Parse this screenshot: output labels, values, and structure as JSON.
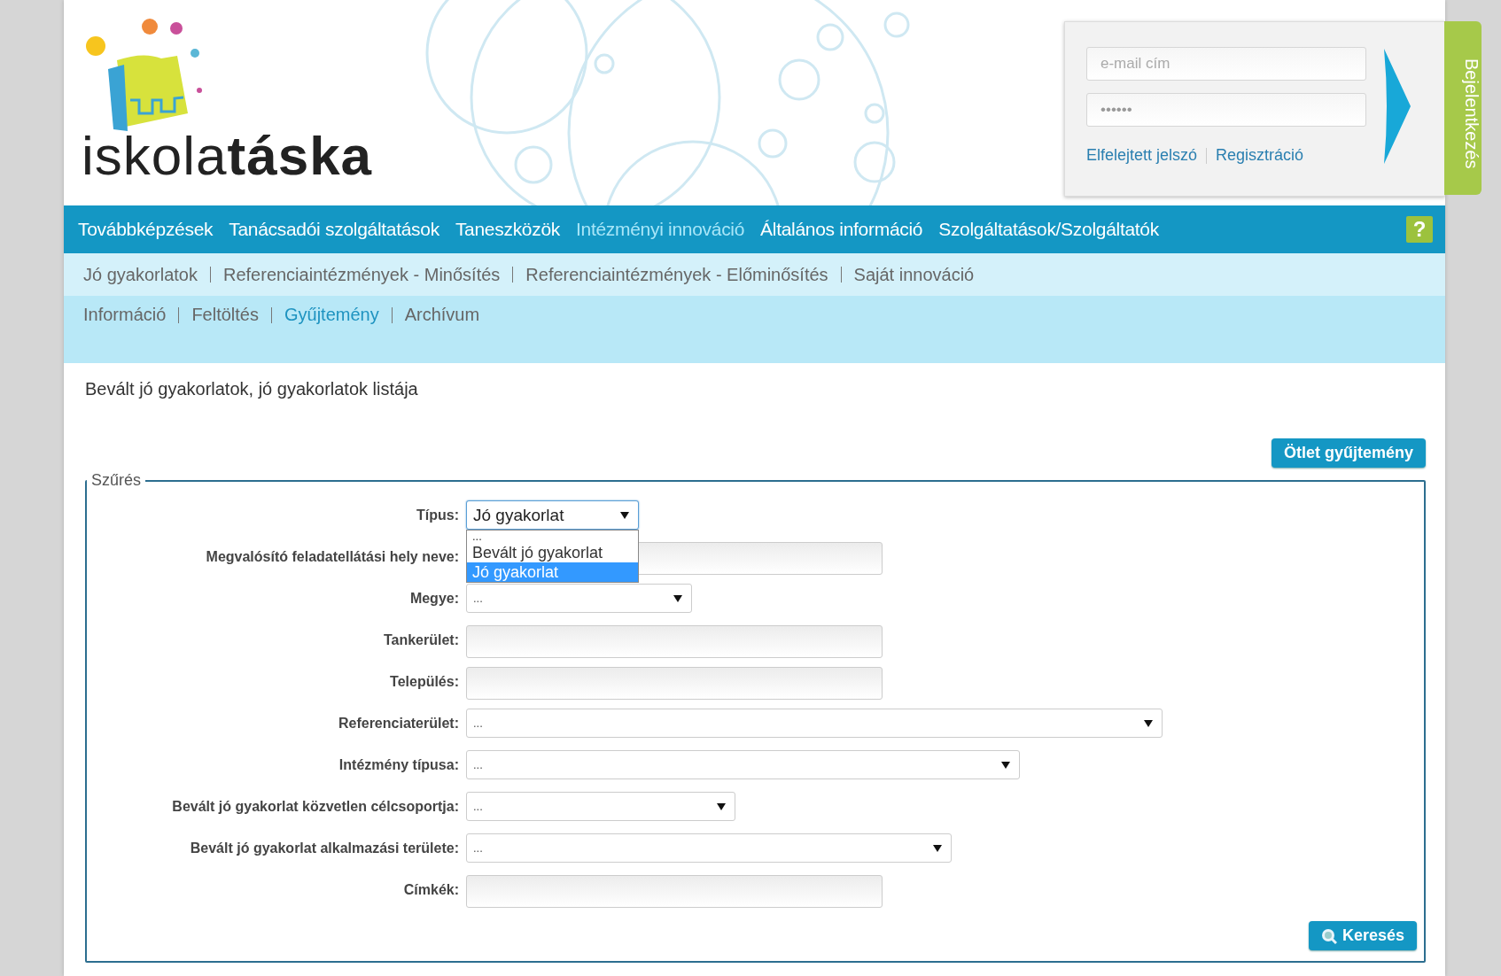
{
  "header": {
    "logo": {
      "light": "iskola",
      "bold": "táska"
    },
    "login": {
      "email_placeholder": "e-mail cím",
      "password_value": "••••••",
      "links": [
        "Elfelejtett jelszó",
        "Regisztráció"
      ],
      "side_tab": "Bejelentkezés"
    }
  },
  "main_nav": {
    "items": [
      {
        "label": "Továbbképzések",
        "selected": false
      },
      {
        "label": "Tanácsadói szolgáltatások",
        "selected": false
      },
      {
        "label": "Taneszközök",
        "selected": false
      },
      {
        "label": "Intézményi innováció",
        "selected": true
      },
      {
        "label": "Általános információ",
        "selected": false
      },
      {
        "label": "Szolgáltatások/Szolgáltatók",
        "selected": false
      }
    ],
    "help": "?"
  },
  "sub_nav": {
    "items": [
      {
        "label": "Jó gyakorlatok",
        "selected": false
      },
      {
        "label": "Referenciaintézmények - Minősítés",
        "selected": false
      },
      {
        "label": "Referenciaintézmények - Előminősítés",
        "selected": false
      },
      {
        "label": "Saját innováció",
        "selected": false
      }
    ]
  },
  "sub_nav_2": {
    "items": [
      {
        "label": "Információ",
        "selected": false
      },
      {
        "label": "Feltöltés",
        "selected": false
      },
      {
        "label": "Gyűjtemény",
        "selected": true
      },
      {
        "label": "Archívum",
        "selected": false
      }
    ]
  },
  "page_title": "Bevált jó gyakorlatok, jó gyakorlatok listája",
  "idea_button": "Ötlet gyűjtemény",
  "filter": {
    "legend": "Szűrés",
    "fields": [
      {
        "kind": "select",
        "label": "Típus:",
        "value": "Jó gyakorlat",
        "expanded": true,
        "options": [
          {
            "label": "...",
            "selected": false
          },
          {
            "label": "Bevált jó gyakorlat",
            "selected": false
          },
          {
            "label": "Jó gyakorlat",
            "selected": true
          }
        ]
      },
      {
        "kind": "text",
        "label": "Megvalósító feladatellátási hely neve:"
      },
      {
        "kind": "select",
        "label": "Megye:",
        "value": "..."
      },
      {
        "kind": "text",
        "label": "Tankerület:"
      },
      {
        "kind": "text",
        "label": "Település:"
      },
      {
        "kind": "select",
        "label": "Referenciaterület:",
        "value": "..."
      },
      {
        "kind": "select",
        "label": "Intézmény típusa:",
        "value": "..."
      },
      {
        "kind": "select",
        "label": "Bevált jó gyakorlat közvetlen célcsoportja:",
        "value": "..."
      },
      {
        "kind": "select",
        "label": "Bevált jó gyakorlat alkalmazási területe:",
        "value": "..."
      },
      {
        "kind": "text",
        "label": "Címkék:"
      }
    ],
    "search_button": "Keresés"
  }
}
